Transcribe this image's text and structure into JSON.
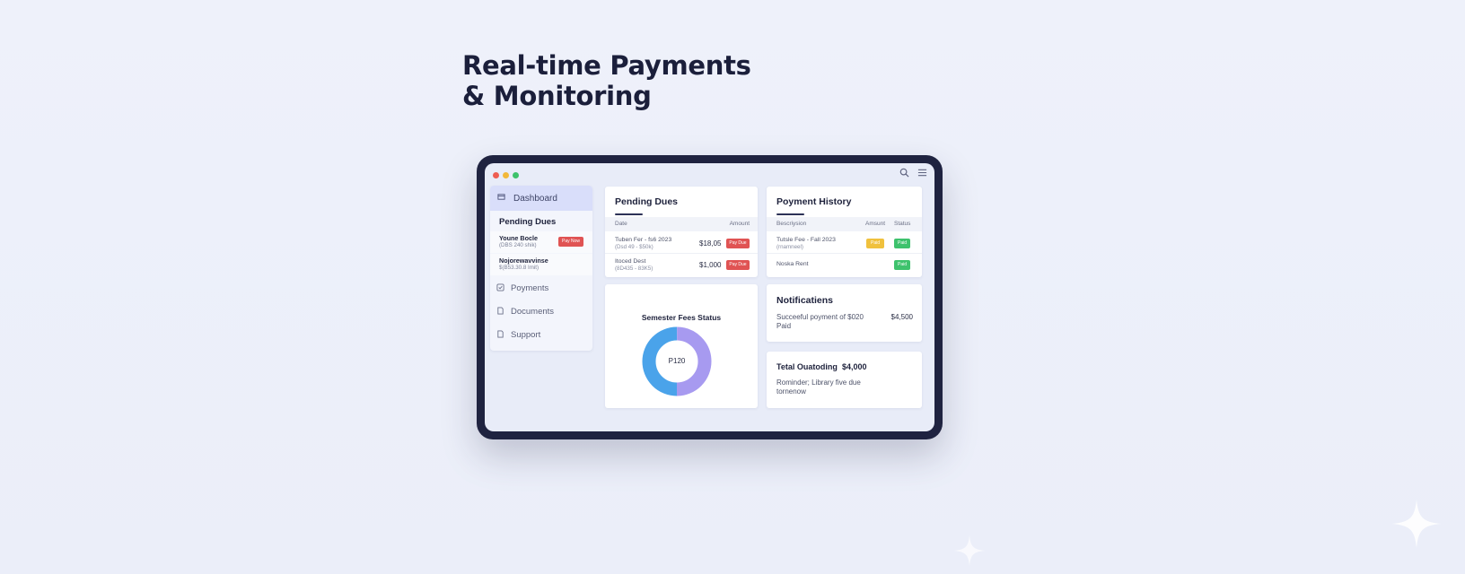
{
  "headline": {
    "line1": "Real-time Payments",
    "line2": "& Monitoring"
  },
  "icons": {
    "search": "search-icon",
    "menu": "menu-icon",
    "dashboard": "dashboard-icon",
    "payments": "payments-icon",
    "documents": "document-icon",
    "support": "support-icon"
  },
  "colors": {
    "accent": "#2d3257",
    "red": "#e05353",
    "yellow": "#f0c13d",
    "green": "#3ec26d",
    "donut_blue": "#4aa3ea",
    "donut_purple": "#a79af0"
  },
  "sidebar": {
    "dashboard_label": "Dashboard",
    "section_title": "Pending Dues",
    "dues": [
      {
        "name": "Youne Bocle",
        "sub": "(DBS 240 shik)",
        "badge": "Pay Now"
      },
      {
        "name": "Nojorewavvinse",
        "sub": "$(B53.30.8 Imit)"
      }
    ],
    "nav": [
      "Poyments",
      "Documents",
      "Support"
    ]
  },
  "pending_dues": {
    "title": "Pending Dues",
    "col_date": "Date",
    "col_amount": "Amount",
    "rows": [
      {
        "line1": "Tuben Fer - fs6 2023",
        "line2": "(Dsd 49 - $50k)",
        "amount": "$18,05",
        "badge": "Pay Due"
      },
      {
        "line1": "Itoced Dest",
        "line2": "(8D435 - 83K5)",
        "amount": "$1,000",
        "badge": "Pay Due"
      }
    ]
  },
  "payment_history": {
    "title": "Poyment History",
    "col_desc": "Bescriysion",
    "col_amount": "Amsunt",
    "col_status": "Status",
    "rows": [
      {
        "line1": "Tutsle Fee - Fall 2023",
        "line2": "(rnamneel)",
        "amount_badge": "Paid",
        "status_badge": "Paid"
      },
      {
        "line1": "Noska Rent",
        "status_badge": "Paid"
      }
    ]
  },
  "semester_fees": {
    "title": "Semester Fees Status",
    "center_label": "P120",
    "segments": [
      {
        "color": "#4aa3ea",
        "fraction": 0.5
      },
      {
        "color": "#a79af0",
        "fraction": 0.5
      }
    ]
  },
  "notifications": {
    "title": "Notificatiens",
    "text": "Succeeful poyment of $020 Paid",
    "amount": "$4,500"
  },
  "total": {
    "title": "Tetal Ouatoding",
    "amount": "$4,000",
    "reminder": "Rominder; Library five due tornenow"
  }
}
